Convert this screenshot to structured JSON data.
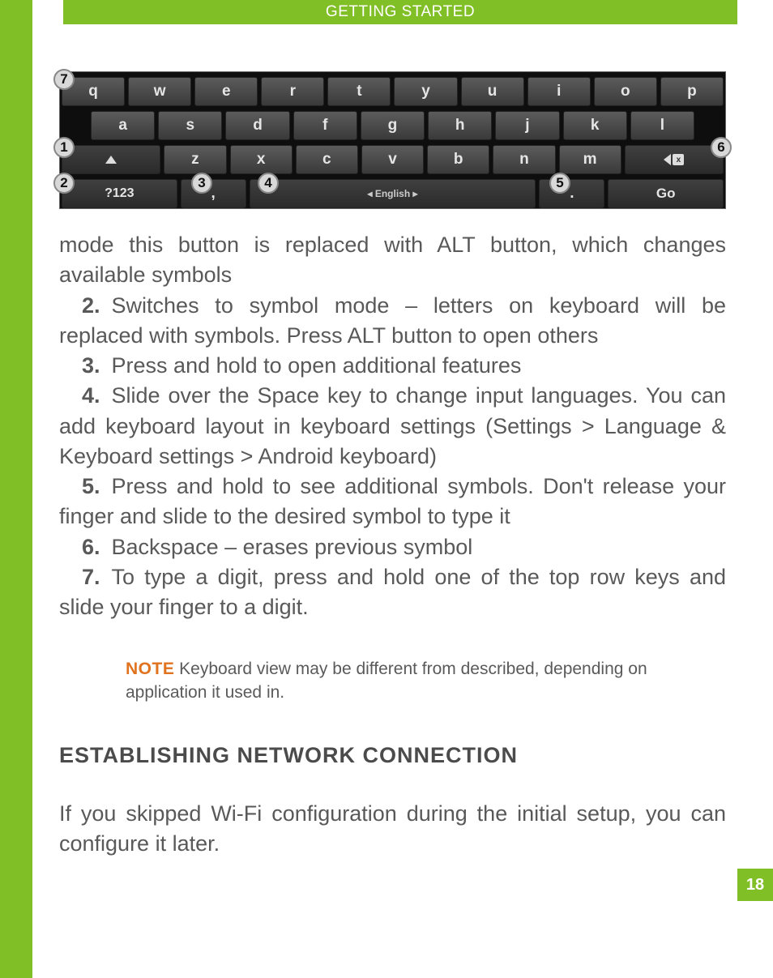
{
  "header": {
    "title": "GETTING STARTED"
  },
  "page_number": "18",
  "keyboard": {
    "row1": [
      "q",
      "w",
      "e",
      "r",
      "t",
      "y",
      "u",
      "i",
      "o",
      "p"
    ],
    "row2": [
      "a",
      "s",
      "d",
      "f",
      "g",
      "h",
      "j",
      "k",
      "l"
    ],
    "row3": {
      "z": "z",
      "x": "x",
      "c": "c",
      "v": "v",
      "b": "b",
      "n": "n",
      "m": "m"
    },
    "row4": {
      "sym": "?123",
      "comma": ",",
      "space": "◂ English ▸",
      "period": ".",
      "go": "Go"
    },
    "callouts": {
      "c1": "1",
      "c2": "2",
      "c3": "3",
      "c4": "4",
      "c5": "5",
      "c6": "6",
      "c7": "7"
    }
  },
  "body": {
    "intro": "mode this button is replaced with ALT button, which changes available symbols",
    "items": {
      "n2": "2.",
      "t2": "Switches to symbol mode – letters on keyboard will be replaced with symbols. Press ALT button to open others",
      "n3": "3.",
      "t3": "Press and hold to open additional features",
      "n4": "4.",
      "t4": "Slide over the Space key to change input languages. You can add keyboard layout in keyboard settings (Settings > Language & Keyboard settings > Android keyboard)",
      "n5": "5.",
      "t5": "Press and hold to see additional symbols. Don't release your finger and slide to the desired symbol to type it",
      "n6": "6.",
      "t6": "Backspace – erases previous symbol",
      "n7": "7.",
      "t7": "To type a digit, press and hold one of the top row keys and slide your finger to a digit."
    }
  },
  "note": {
    "label": "NOTE",
    "text": " Keyboard view may be different from described, depending on application it used in."
  },
  "section_heading": "ESTABLISHING NETWORK CONNECTION",
  "after_text": "If you skipped Wi-Fi configuration during the initial setup, you can configure it later."
}
